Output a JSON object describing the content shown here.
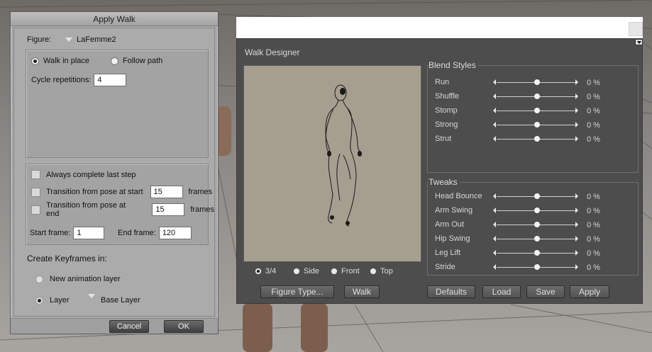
{
  "apply_walk": {
    "title": "Apply Walk",
    "figure_label": "Figure:",
    "figure_value": "LaFemme2",
    "walk_in_place": "Walk in place",
    "follow_path": "Follow path",
    "cycle_label": "Cycle repetitions:",
    "cycle_value": "4",
    "always_complete": "Always complete last step",
    "transition_start": "Transition from pose at start",
    "transition_start_value": "15",
    "transition_end": "Transition from pose at end",
    "transition_end_value": "15",
    "frames_unit": "frames",
    "start_frame_label": "Start frame:",
    "start_frame_value": "1",
    "end_frame_label": "End frame:",
    "end_frame_value": "120",
    "create_keyframes": "Create Keyframes in:",
    "new_animation_layer": "New animation layer",
    "layer_label": "Layer",
    "layer_value": "Base Layer",
    "cancel": "Cancel",
    "ok": "OK"
  },
  "walk_designer": {
    "title": "Walk Designer",
    "views": [
      "3/4",
      "Side",
      "Front",
      "Top"
    ],
    "selected_view": "3/4",
    "figure_type_button": "Figure Type...",
    "walk_button": "Walk",
    "blend_styles_title": "Blend Styles",
    "blend_styles": [
      {
        "label": "Run",
        "value": "0 %",
        "level": 0.5
      },
      {
        "label": "Shuffle",
        "value": "0 %",
        "level": 0.5
      },
      {
        "label": "Stomp",
        "value": "0 %",
        "level": 0.5
      },
      {
        "label": "Strong",
        "value": "0 %",
        "level": 0.5
      },
      {
        "label": "Strut",
        "value": "0 %",
        "level": 0.5
      }
    ],
    "tweaks_title": "Tweaks",
    "tweaks": [
      {
        "label": "Head Bounce",
        "value": "0 %",
        "level": 0.5
      },
      {
        "label": "Arm Swing",
        "value": "0 %",
        "level": 0.5
      },
      {
        "label": "Arm Out",
        "value": "0 %",
        "level": 0.5
      },
      {
        "label": "Hip Swing",
        "value": "0 %",
        "level": 0.5
      },
      {
        "label": "Leg Lift",
        "value": "0 %",
        "level": 0.5
      },
      {
        "label": "Stride",
        "value": "0 %",
        "level": 0.5
      }
    ],
    "defaults_button": "Defaults",
    "load_button": "Load",
    "save_button": "Save",
    "apply_button": "Apply"
  }
}
